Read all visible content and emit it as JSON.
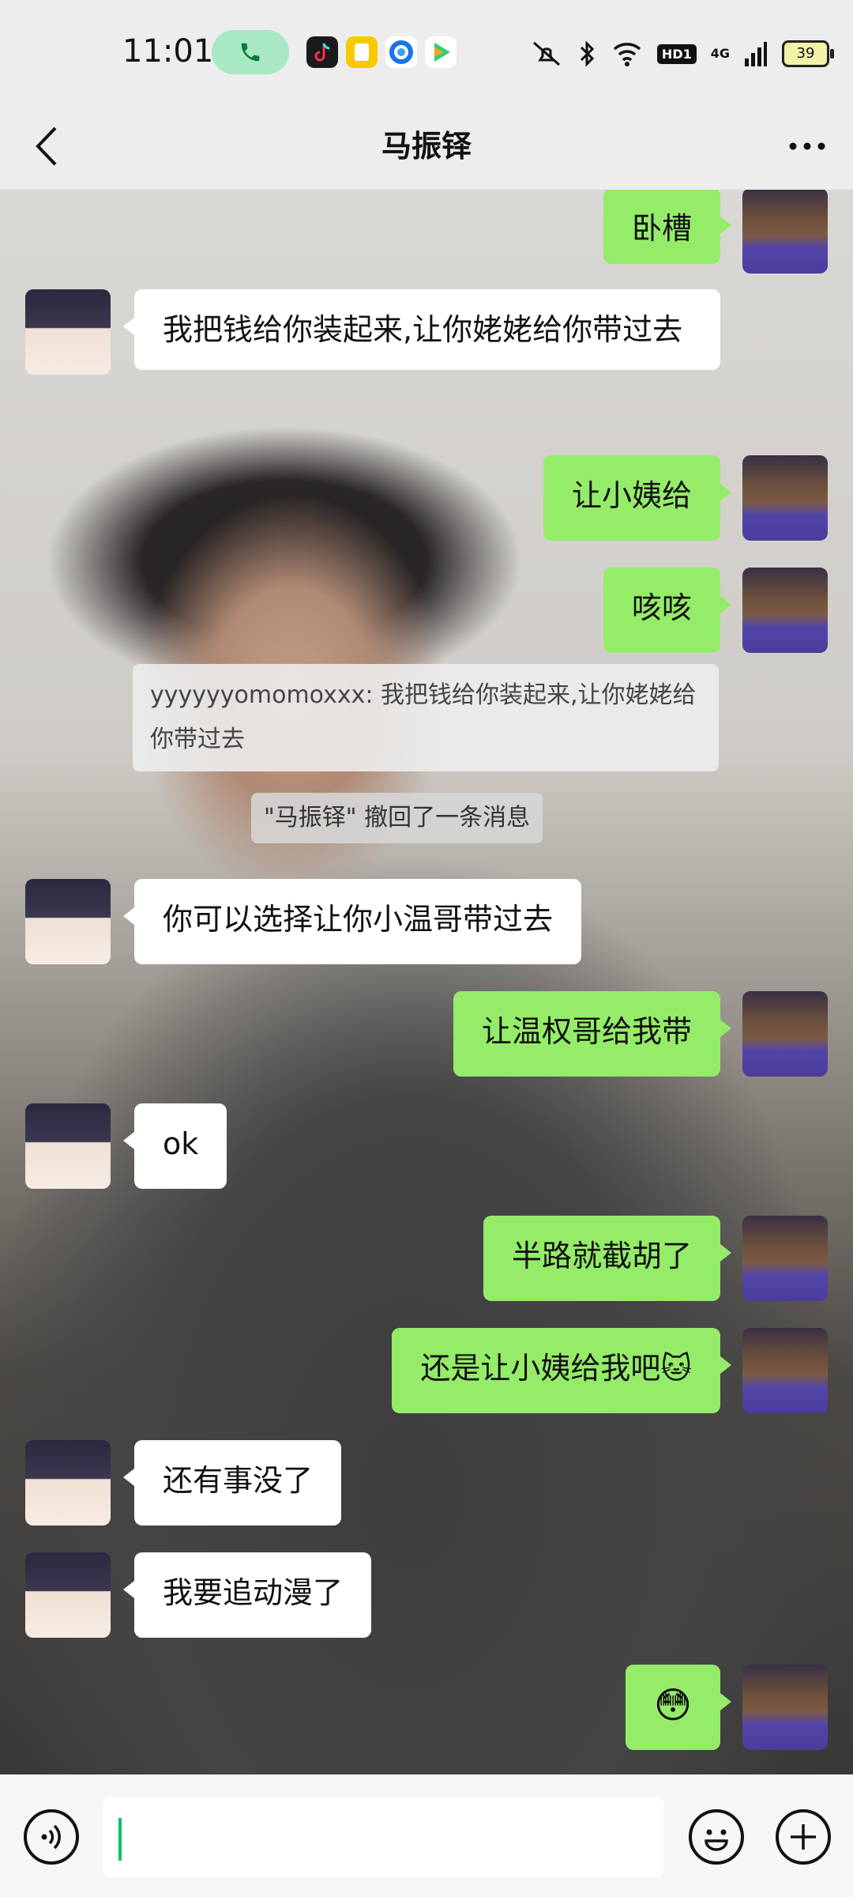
{
  "status_bar": {
    "time": "11:01",
    "battery": "39",
    "network": "4G",
    "hd": "HD1"
  },
  "header": {
    "title": "马振铎"
  },
  "messages": [
    {
      "side": "right",
      "text": "卧槽"
    },
    {
      "side": "left",
      "text": "我把钱给你装起来,让你姥姥给你带过去"
    },
    {
      "side": "right",
      "text": "让小姨给"
    },
    {
      "side": "right",
      "text": "咳咳"
    },
    {
      "side": "quote",
      "text": "yyyyyyomomoxxx: 我把钱给你装起来,让你姥姥给你带过去"
    },
    {
      "side": "system",
      "text": "\"马振铎\" 撤回了一条消息"
    },
    {
      "side": "left",
      "text": "你可以选择让你小温哥带过去"
    },
    {
      "side": "right",
      "text": "让温权哥给我带"
    },
    {
      "side": "left",
      "text": "ok"
    },
    {
      "side": "right",
      "text": "半路就截胡了"
    },
    {
      "side": "right",
      "text": "还是让小姨给我吧",
      "emoji": "🐱"
    },
    {
      "side": "left",
      "text": "还有事没了"
    },
    {
      "side": "left",
      "text": "我要追动漫了"
    },
    {
      "side": "right",
      "text": "",
      "emoji": "😳"
    }
  ],
  "icons": {
    "back": "chevron-left-icon",
    "more": "more-dots-icon",
    "voice": "voice-icon",
    "emoji": "emoji-icon",
    "plus": "plus-icon",
    "call": "phone-icon"
  },
  "colors": {
    "bubble_green": "#95ec69",
    "bubble_white": "#ffffff",
    "accent": "#07c160"
  }
}
